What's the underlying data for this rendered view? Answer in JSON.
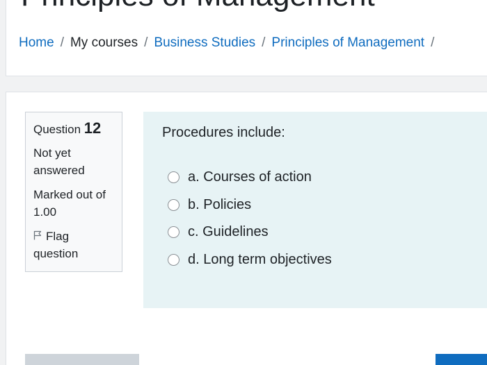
{
  "header": {
    "course_title": "Principles of Management",
    "breadcrumb": [
      "Home",
      "My courses",
      "Business Studies",
      "Principles of Management"
    ],
    "separator": "/"
  },
  "question_info": {
    "label": "Question",
    "number": "12",
    "state": "Not yet answered",
    "grade": "Marked out of 1.00",
    "flag_label": "Flag question"
  },
  "question": {
    "text": "Procedures include:",
    "answers": [
      "a. Courses of action",
      "b. Policies",
      "c. Guidelines",
      "d. Long term objectives"
    ]
  },
  "colors": {
    "link": "#0f6cbf",
    "content_bg": "#e7f3f5",
    "info_bg": "#f8f9fa",
    "primary_button": "#0f6cbf",
    "secondary_button": "#ced4da"
  },
  "icons": {
    "flag": "flag-outline-icon",
    "radio": "radio-empty-icon"
  }
}
